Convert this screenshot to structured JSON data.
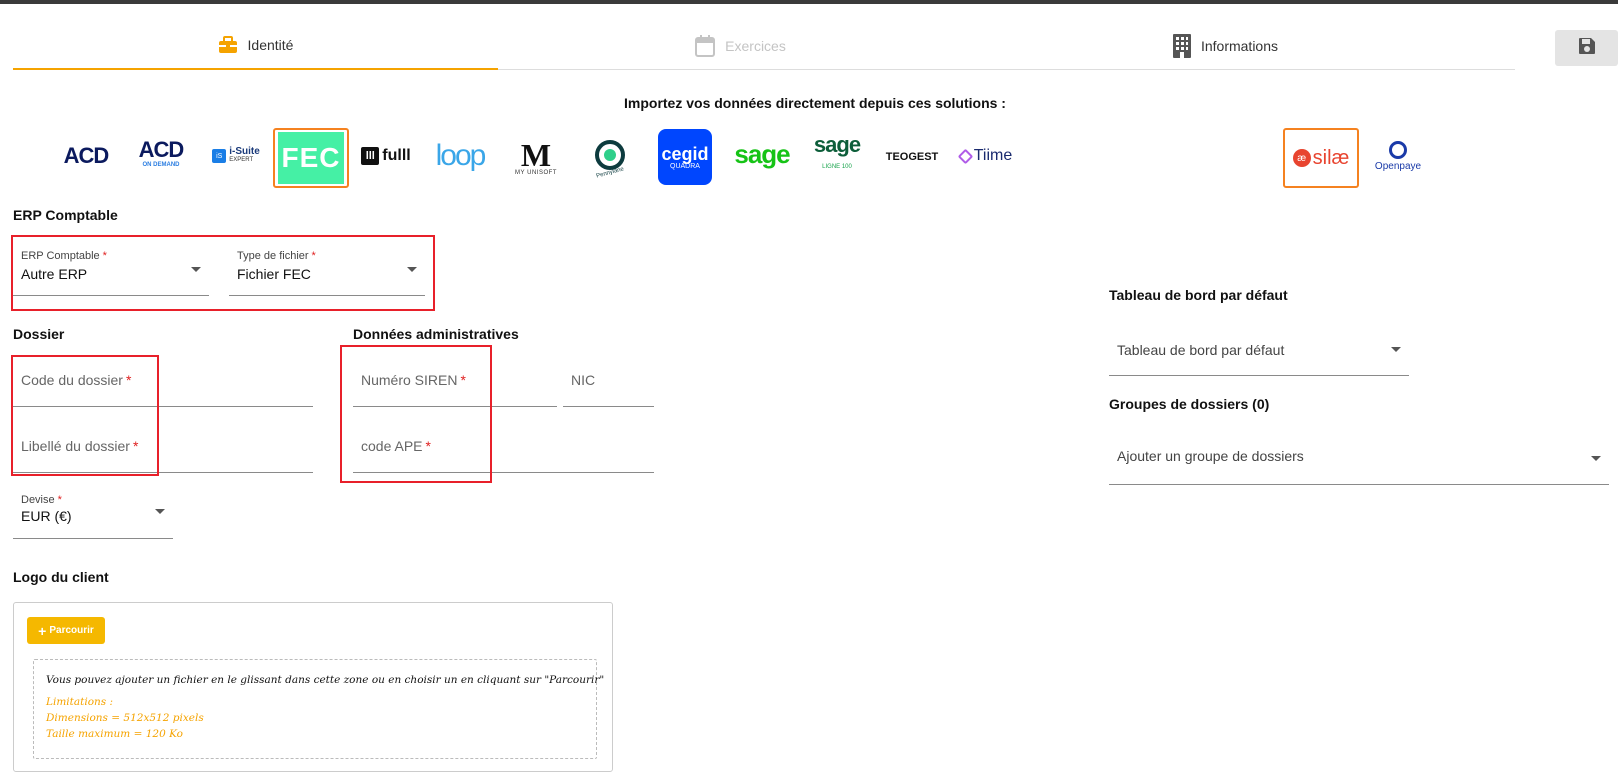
{
  "tabs": [
    {
      "label": "Identité",
      "icon": "briefcase-icon",
      "state": "active"
    },
    {
      "label": "Exercices",
      "icon": "calendar-icon",
      "state": "disabled"
    },
    {
      "label": "Informations",
      "icon": "building-icon",
      "state": "normal"
    }
  ],
  "save_icon": "floppy-disk-icon",
  "import": {
    "title": "Importez vos données directement depuis ces solutions :",
    "logos": {
      "acd": "ACD",
      "acd_on_demand": {
        "name": "ACD",
        "sub": "ON DEMAND"
      },
      "isuite": {
        "badge": "iS",
        "name": "i-Suite",
        "sub": "EXPERT"
      },
      "fec": "FEC",
      "fulll": {
        "mark": "lll",
        "name": "fulll"
      },
      "loop": "loop",
      "unisoft": {
        "mark": "M",
        "sub": "MY UNISOFT"
      },
      "pennylane": "Pennylane",
      "cegid": {
        "name": "cegid",
        "sub": "QUADRA"
      },
      "sage": "sage",
      "sage_ligne": {
        "name": "sage",
        "sub": "LIGNE 100"
      },
      "teogest": "TEOGEST",
      "tiime": "Tiime",
      "silae": {
        "badge": "æ",
        "name": "silæ"
      },
      "openpaye": "Openpaye"
    }
  },
  "erp_section": {
    "title": "ERP Comptable",
    "erp": {
      "label": "ERP Comptable",
      "value": "Autre ERP"
    },
    "file_type": {
      "label": "Type de fichier",
      "value": "Fichier FEC"
    }
  },
  "dossier": {
    "title": "Dossier",
    "code_label": "Code du dossier",
    "libelle_label": "Libellé du dossier",
    "devise": {
      "label": "Devise",
      "value": "EUR (€)"
    }
  },
  "admin": {
    "title": "Données administratives",
    "siren_label": "Numéro SIREN",
    "nic_label": "NIC",
    "ape_label": "code APE"
  },
  "dashboard": {
    "title": "Tableau de bord par défaut",
    "placeholder": "Tableau de bord par défaut"
  },
  "groups": {
    "title": "Groupes de dossiers (0)",
    "placeholder": "Ajouter un groupe de dossiers"
  },
  "logo_client": {
    "title": "Logo du client",
    "browse_label": "Parcourir",
    "drop_text": "Vous pouvez ajouter un fichier en le glissant dans cette zone ou en choisir un en cliquant sur \"Parcourir\"",
    "limitations": [
      "Limitations :",
      "Dimensions = 512x512 pixels",
      "Taille maximum = 120 Ko"
    ]
  },
  "required_mark": "*",
  "colors": {
    "accent": "#f5a300",
    "required": "#e02020",
    "highlight_box": "#e8202a"
  }
}
